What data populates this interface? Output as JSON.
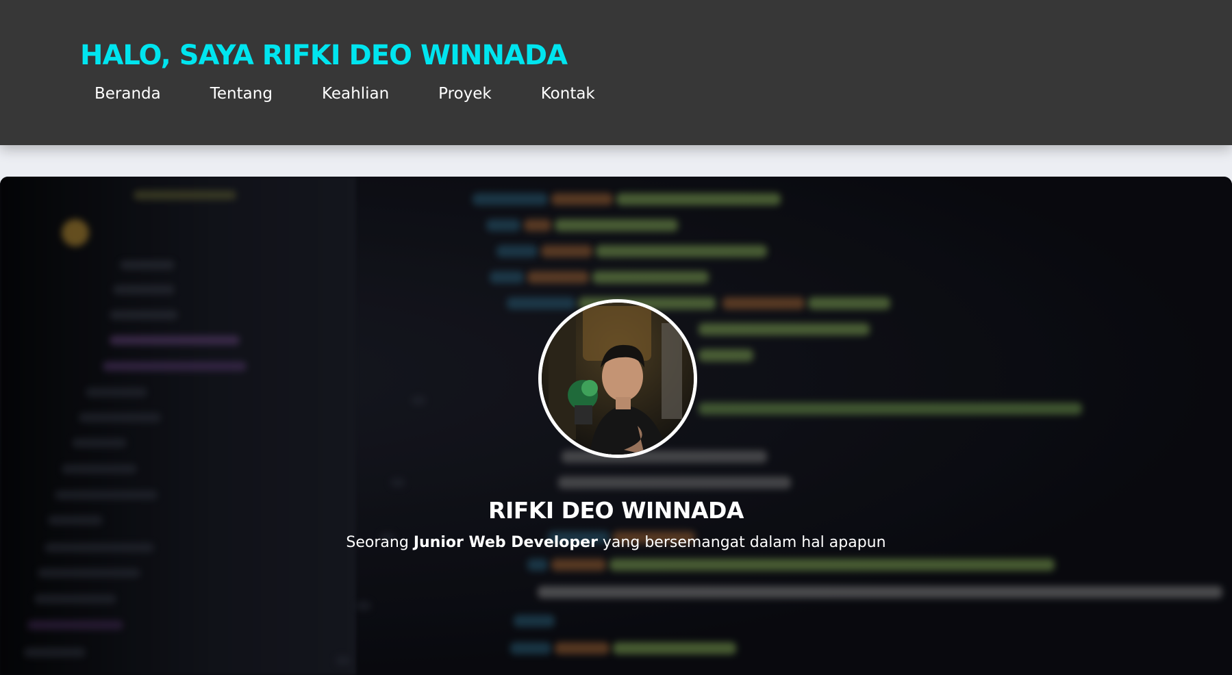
{
  "header": {
    "title": "HALO, SAYA RIFKI DEO WINNADA",
    "title_color": "#00e5ef",
    "background": "#373737",
    "nav": [
      {
        "label": "Beranda"
      },
      {
        "label": "Tentang"
      },
      {
        "label": "Keahlian"
      },
      {
        "label": "Proyek"
      },
      {
        "label": "Kontak"
      }
    ]
  },
  "hero": {
    "background": "blurred-code-editor-image",
    "avatar_icon": "profile-photo",
    "name": "RIFKI DEO WINNADA",
    "tagline_prefix": "Seorang ",
    "tagline_role": "Junior Web Developer",
    "tagline_suffix": " yang bersemangat dalam hal apapun"
  }
}
